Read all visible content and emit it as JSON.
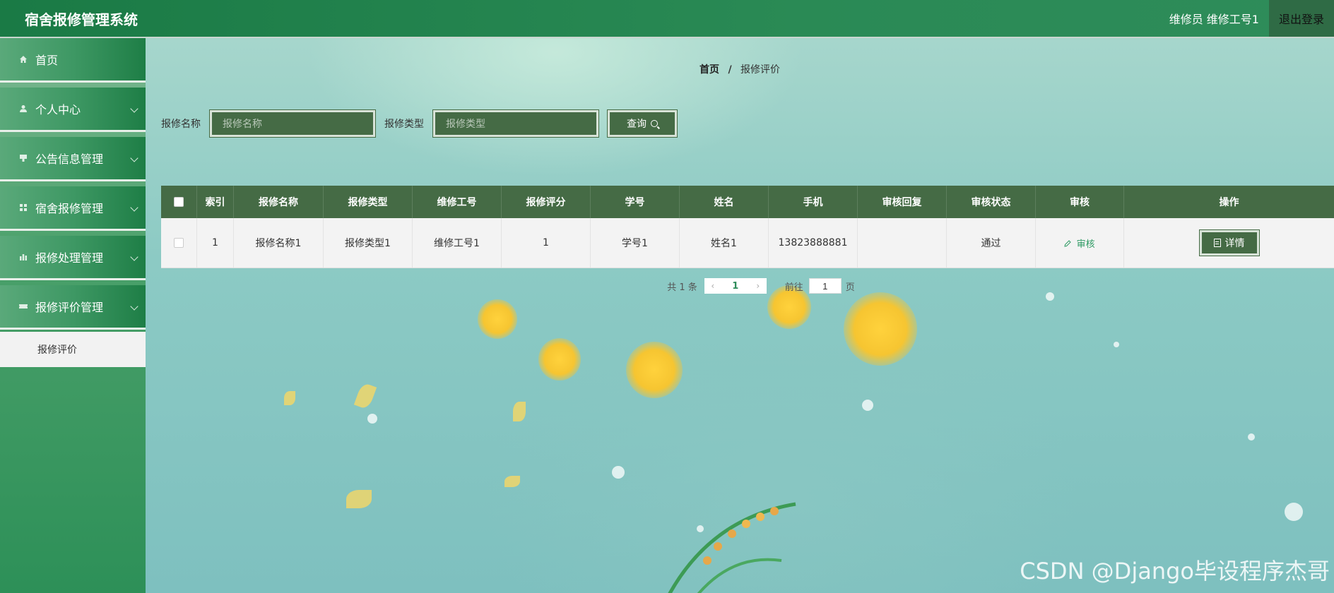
{
  "header": {
    "title": "宿舍报修管理系统",
    "user_info": "维修员 维修工号1",
    "logout_label": "退出登录"
  },
  "sidebar": {
    "items": [
      {
        "label": "首页",
        "icon": "home-icon",
        "has_children": false
      },
      {
        "label": "个人中心",
        "icon": "user-icon",
        "has_children": true
      },
      {
        "label": "公告信息管理",
        "icon": "notice-icon",
        "has_children": true
      },
      {
        "label": "宿舍报修管理",
        "icon": "grid-icon",
        "has_children": true
      },
      {
        "label": "报修处理管理",
        "icon": "chart-icon",
        "has_children": true
      },
      {
        "label": "报修评价管理",
        "icon": "ticket-icon",
        "has_children": true
      }
    ],
    "submenu": {
      "label": "报修评价"
    }
  },
  "breadcrumb": {
    "home": "首页",
    "separator": "/",
    "current": "报修评价"
  },
  "search": {
    "name_label": "报修名称",
    "name_placeholder": "报修名称",
    "type_label": "报修类型",
    "type_placeholder": "报修类型",
    "button_label": "查询"
  },
  "table": {
    "headers": [
      "索引",
      "报修名称",
      "报修类型",
      "维修工号",
      "报修评分",
      "学号",
      "姓名",
      "手机",
      "审核回复",
      "审核状态",
      "审核",
      "操作"
    ],
    "rows": [
      {
        "index": "1",
        "name": "报修名称1",
        "type": "报修类型1",
        "worker_id": "维修工号1",
        "score": "1",
        "student_id": "学号1",
        "student_name": "姓名1",
        "phone": "13823888881",
        "reply": "",
        "status": "通过",
        "audit_label": "审核",
        "detail_label": "详情"
      }
    ]
  },
  "pagination": {
    "total_text": "共 1 条",
    "current_page": "1",
    "goto_label": "前往",
    "goto_value": "1",
    "page_word": "页"
  },
  "watermark": "CSDN @Django毕设程序杰哥",
  "colors": {
    "header_green": "#1a7a45",
    "accent_dark_green": "#456b45",
    "status_green": "#2e9a63"
  }
}
